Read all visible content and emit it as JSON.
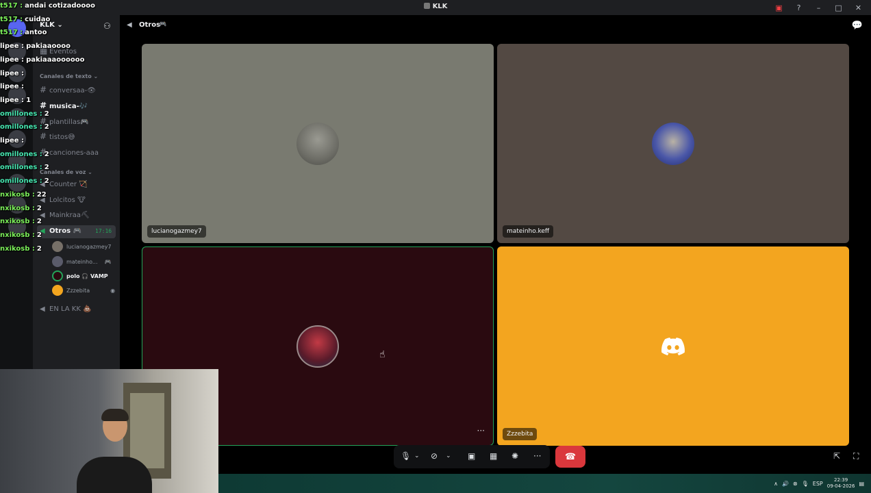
{
  "window": {
    "title": "KLK",
    "icons": [
      "notification-icon",
      "help-icon",
      "minimize-icon",
      "maximize-icon",
      "close-icon"
    ]
  },
  "server": {
    "name": "KLK",
    "events_label": "Eventos",
    "text_category": "Canales de texto",
    "voice_category": "Canales de voz",
    "text_channels": [
      {
        "name": "conversaa-👁",
        "bright": false
      },
      {
        "name": "musica-🎶",
        "bright": true
      },
      {
        "name": "plantillas🎮",
        "bright": false
      },
      {
        "name": "tistos😅",
        "bright": false
      },
      {
        "name": "canciones-aaa",
        "bright": false
      }
    ],
    "voice_channels": [
      {
        "name": "Counter 🏹"
      },
      {
        "name": "Lolcitos 🐮"
      },
      {
        "name": "Mainkraa⛏"
      },
      {
        "name": "Otros 🎮",
        "timer": "17:16"
      },
      {
        "name": "EN LA KK 💩"
      }
    ],
    "members": [
      {
        "name": "lucianogazmey7"
      },
      {
        "name": "mateinho...",
        "badge": "🎮"
      },
      {
        "name": "polo 🎧 VAMP"
      },
      {
        "name": "Zzzebita"
      }
    ]
  },
  "chat_overlay": [
    {
      "user": "t517 :",
      "msg": "andai cotizadoooo",
      "color": "green"
    },
    {
      "user": "t517 :",
      "msg": "cuidao",
      "color": "green"
    },
    {
      "user": "t517 :",
      "msg": "antoo",
      "color": "green"
    },
    {
      "user": "lipee :",
      "msg": "pakiaaoooo",
      "color": "white"
    },
    {
      "user": "lipee :",
      "msg": "pakiaaaoooooo",
      "color": "white"
    },
    {
      "user": "lipee :",
      "msg": "",
      "color": "white"
    },
    {
      "user": "lipee :",
      "msg": "",
      "color": "white"
    },
    {
      "user": "lipee :",
      "msg": "1",
      "color": "white"
    },
    {
      "user": "omillones :",
      "msg": "2",
      "color": "teal"
    },
    {
      "user": "omillones :",
      "msg": "2",
      "color": "teal"
    },
    {
      "user": "lipee :",
      "msg": "",
      "color": "white"
    },
    {
      "user": "omillones :",
      "msg": "2",
      "color": "teal"
    },
    {
      "user": "omillones :",
      "msg": "2",
      "color": "teal"
    },
    {
      "user": "omillones :",
      "msg": "2",
      "color": "teal"
    },
    {
      "user": "nxikosb :",
      "msg": "22",
      "color": "green"
    },
    {
      "user": "nxikosb :",
      "msg": "2",
      "color": "green"
    },
    {
      "user": "nxikosb :",
      "msg": "2",
      "color": "green"
    },
    {
      "user": "nxikosb :",
      "msg": "2",
      "color": "green"
    },
    {
      "user": "nxikosb :",
      "msg": "2",
      "color": "green"
    }
  ],
  "voice_header": {
    "channel": "Otros",
    "emoji": "🎮"
  },
  "tiles": [
    {
      "name": "lucianogazmey7"
    },
    {
      "name": "mateinho.keff"
    },
    {
      "name": ""
    },
    {
      "name": "Zzzebita"
    }
  ],
  "controls": {
    "more_label": "···"
  },
  "taskbar": {
    "lang": "ESP",
    "time": "22:39",
    "date": "09-04-2026"
  }
}
